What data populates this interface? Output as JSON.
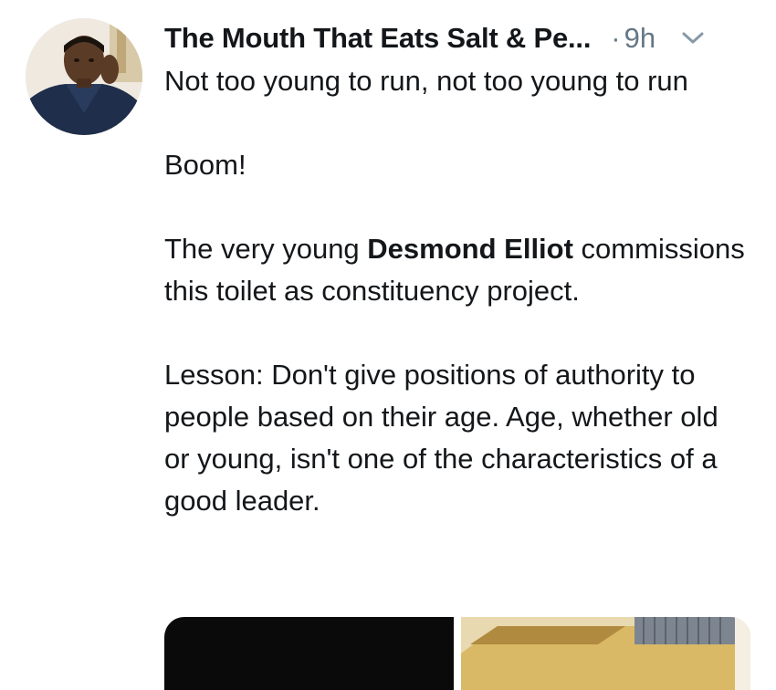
{
  "tweet": {
    "display_name": "The Mouth That Eats Salt & Pe...",
    "separator": "·",
    "timestamp": "9h",
    "text": {
      "line1": "Not too young to run, not too young to run",
      "line2": "Boom!",
      "line3_prefix": "The very young ",
      "line3_bold": "Desmond Elliot",
      "line3_suffix": " commissions this toilet as constituency project.",
      "line4": "Lesson: Don't give positions of authority to people based on their age. Age, whether old or young, isn't one of the characteristics of a good leader."
    },
    "icons": {
      "caret": "chevron-down-icon"
    },
    "colors": {
      "text": "#14171a",
      "secondary": "#657786"
    }
  }
}
